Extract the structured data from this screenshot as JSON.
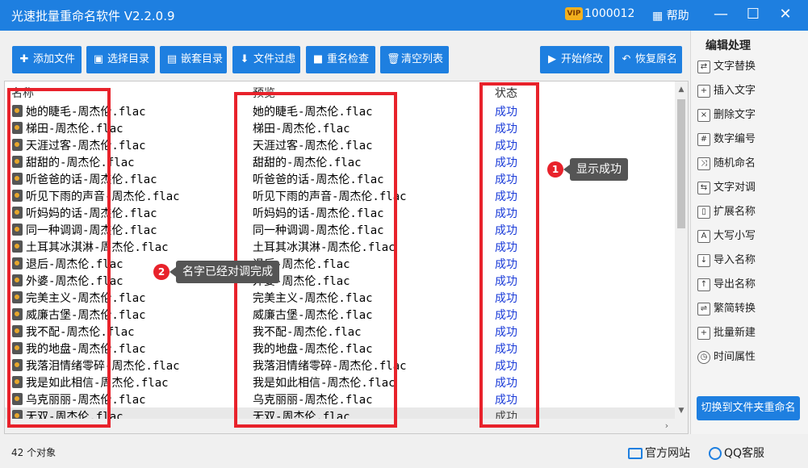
{
  "window": {
    "title": "光速批量重命名软件 V2.2.0.9",
    "vip_badge": "VIP",
    "user_id": "1000012",
    "help_label": "帮助"
  },
  "toolbar": {
    "add_file": "添加文件",
    "select_dir": "选择目录",
    "nested_dir": "嵌套目录",
    "file_filter": "文件过虑",
    "rename_check": "重名检查",
    "clear_list": "清空列表",
    "start_modify": "开始修改",
    "restore_name": "恢复原名"
  },
  "side_panel": {
    "title": "编辑处理",
    "items": [
      "文字替换",
      "插入文字",
      "删除文字",
      "数字编号",
      "随机命名",
      "文字对调",
      "扩展名称",
      "大写小写",
      "导入名称",
      "导出名称",
      "繁简转换",
      "批量新建",
      "时间属性"
    ],
    "switch_button": "切换到文件夹重命名"
  },
  "list": {
    "columns": {
      "name": "名称",
      "preview": "预览",
      "status": "状态"
    },
    "rows": [
      {
        "name": "她的睫毛-周杰伦.flac",
        "preview": "她的睫毛-周杰伦.flac",
        "status": "成功"
      },
      {
        "name": "梯田-周杰伦.flac",
        "preview": "梯田-周杰伦.flac",
        "status": "成功"
      },
      {
        "name": "天涯过客-周杰伦.flac",
        "preview": "天涯过客-周杰伦.flac",
        "status": "成功"
      },
      {
        "name": "甜甜的-周杰伦.flac",
        "preview": "甜甜的-周杰伦.flac",
        "status": "成功"
      },
      {
        "name": "听爸爸的话-周杰伦.flac",
        "preview": "听爸爸的话-周杰伦.flac",
        "status": "成功"
      },
      {
        "name": "听见下雨的声音-周杰伦.flac",
        "preview": "听见下雨的声音-周杰伦.flac",
        "status": "成功"
      },
      {
        "name": "听妈妈的话-周杰伦.flac",
        "preview": "听妈妈的话-周杰伦.flac",
        "status": "成功"
      },
      {
        "name": "同一种调调-周杰伦.flac",
        "preview": "同一种调调-周杰伦.flac",
        "status": "成功"
      },
      {
        "name": "土耳其冰淇淋-周杰伦.flac",
        "preview": "土耳其冰淇淋-周杰伦.flac",
        "status": "成功"
      },
      {
        "name": "退后-周杰伦.flac",
        "preview": "退后-周杰伦.flac",
        "status": "成功"
      },
      {
        "name": "外婆-周杰伦.flac",
        "preview": "外婆-周杰伦.flac",
        "status": "成功"
      },
      {
        "name": "完美主义-周杰伦.flac",
        "preview": "完美主义-周杰伦.flac",
        "status": "成功"
      },
      {
        "name": "威廉古堡-周杰伦.flac",
        "preview": "威廉古堡-周杰伦.flac",
        "status": "成功"
      },
      {
        "name": "我不配-周杰伦.flac",
        "preview": "我不配-周杰伦.flac",
        "status": "成功"
      },
      {
        "name": "我的地盘-周杰伦.flac",
        "preview": "我的地盘-周杰伦.flac",
        "status": "成功"
      },
      {
        "name": "我落泪情绪零碎-周杰伦.flac",
        "preview": "我落泪情绪零碎-周杰伦.flac",
        "status": "成功"
      },
      {
        "name": "我是如此相信-周杰伦.flac",
        "preview": "我是如此相信-周杰伦.flac",
        "status": "成功"
      },
      {
        "name": "乌克丽丽-周杰伦.flac",
        "preview": "乌克丽丽-周杰伦.flac",
        "status": "成功"
      },
      {
        "name": "无双-周杰伦.flac",
        "preview": "无双-周杰伦.flac",
        "status": "成功"
      }
    ]
  },
  "annotations": {
    "callout1_num": "1",
    "callout1_text": "显示成功",
    "callout2_num": "2",
    "callout2_text": "名字已经对调完成"
  },
  "statusbar": {
    "object_count": "42 个对象",
    "official_site": "官方网站",
    "qq_service": "QQ客服"
  },
  "colors": {
    "accent": "#1e7fe0",
    "highlight_box": "#e8222b",
    "status_success": "#1a3bd8"
  }
}
